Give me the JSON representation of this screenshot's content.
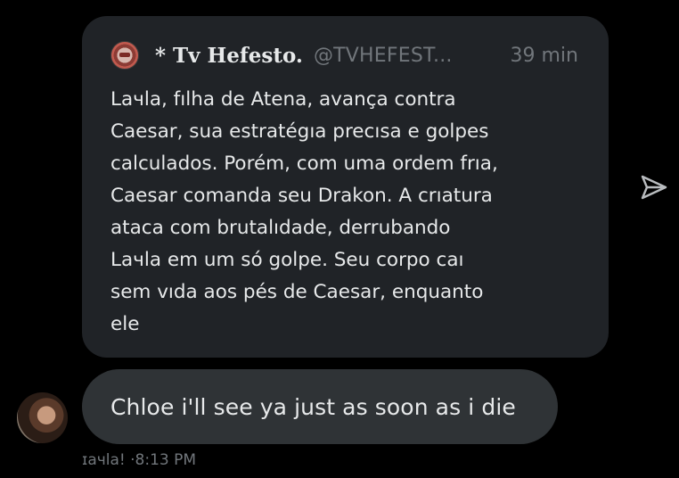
{
  "quoted_post": {
    "display_name": "* Tv Hefesto.",
    "handle": "@TVHEFEST...",
    "time": "39 min",
    "text": "Laчla, fılha de Atena, avança contra\nCaesar, sua estratégıa precısa e golpes\ncalculados. Porém, com uma ordem frıa,\nCaesar comanda seu Drakon. A crıatura\nataca com brutalıdade, derrubando\nLaчla em um só golpe. Seu corpo caı\nsem vıda aos pés de Caesar, enquanto\nele"
  },
  "message": {
    "text": "Chloe i'll see ya just as soon as i die",
    "sender": "ɪaчla!",
    "separator": "·",
    "time": "8:13 PM"
  },
  "icons": {
    "share": "send-icon",
    "quote_avatar": "avatar",
    "sender_avatar": "avatar"
  },
  "colors": {
    "background": "#000000",
    "quote_card": "#202327",
    "bubble": "#2f3336",
    "text_primary": "#e7e9ea",
    "text_secondary": "#71767b"
  }
}
